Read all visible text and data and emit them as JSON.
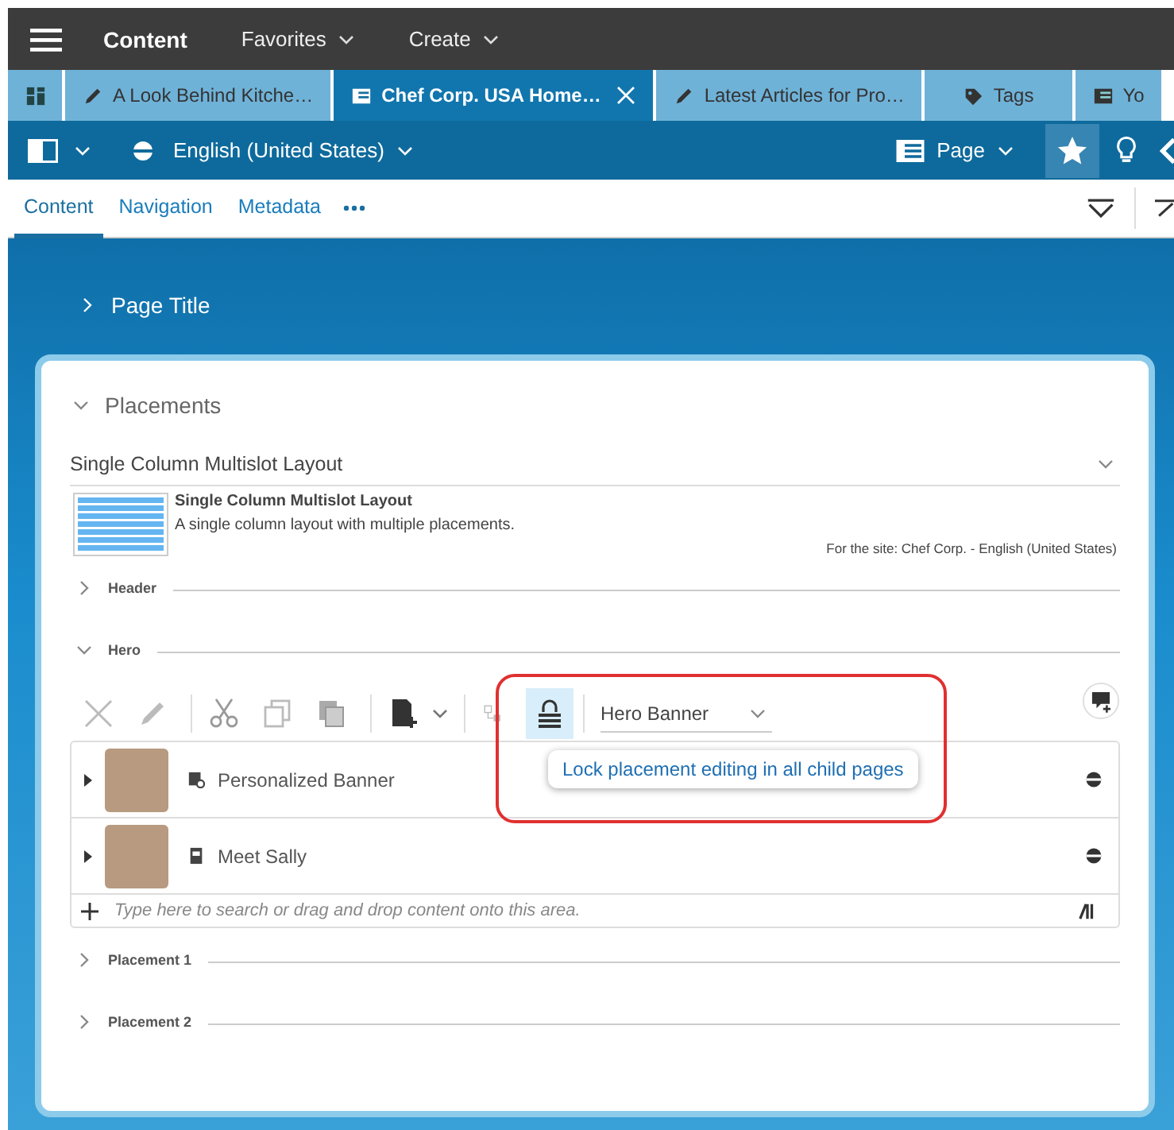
{
  "top_bar": {
    "title": "Content",
    "menus": [
      {
        "label": "Favorites"
      },
      {
        "label": "Create"
      }
    ]
  },
  "tabs": [
    {
      "kind": "dashboard",
      "selected": false,
      "closable": false
    },
    {
      "kind": "edit",
      "label": "A Look Behind Kitche…",
      "selected": false,
      "closable": false
    },
    {
      "kind": "page",
      "label": "Chef Corp. USA Home…",
      "selected": true,
      "closable": true
    },
    {
      "kind": "edit",
      "label": "Latest Articles for Pro…",
      "selected": false,
      "closable": false
    },
    {
      "kind": "tags",
      "label": "Tags",
      "selected": false,
      "closable": false
    },
    {
      "kind": "page",
      "label": "Yo",
      "selected": false,
      "closable": false
    }
  ],
  "toolbar": {
    "language": "English (United States)",
    "view": "Page",
    "favorite_on": true
  },
  "sub_tabs": [
    {
      "label": "Content",
      "selected": true
    },
    {
      "label": "Navigation",
      "selected": false
    },
    {
      "label": "Metadata",
      "selected": false
    }
  ],
  "page_title": {
    "label": "Page Title",
    "expanded": false
  },
  "placements": {
    "label": "Placements",
    "expanded": true,
    "layout_select": "Single Column Multislot Layout",
    "layout": {
      "name": "Single Column Multislot Layout",
      "description": "A single column layout with multiple placements.",
      "site": "For the site: Chef Corp. - English (United States)"
    },
    "sections": [
      {
        "label": "Header",
        "expanded": false
      },
      {
        "label": "Hero",
        "expanded": true
      },
      {
        "label": "Placement 1",
        "expanded": false
      },
      {
        "label": "Placement 2",
        "expanded": false
      }
    ]
  },
  "hero_slot": {
    "lock_on": true,
    "view_select": "Hero Banner",
    "tooltip": "Lock placement editing in all child pages",
    "items": [
      {
        "kind": "personalized",
        "title": "Personalized Banner"
      },
      {
        "kind": "page",
        "title": "Meet Sally"
      }
    ],
    "search_placeholder": "Type here to search or drag and drop content onto this area."
  }
}
